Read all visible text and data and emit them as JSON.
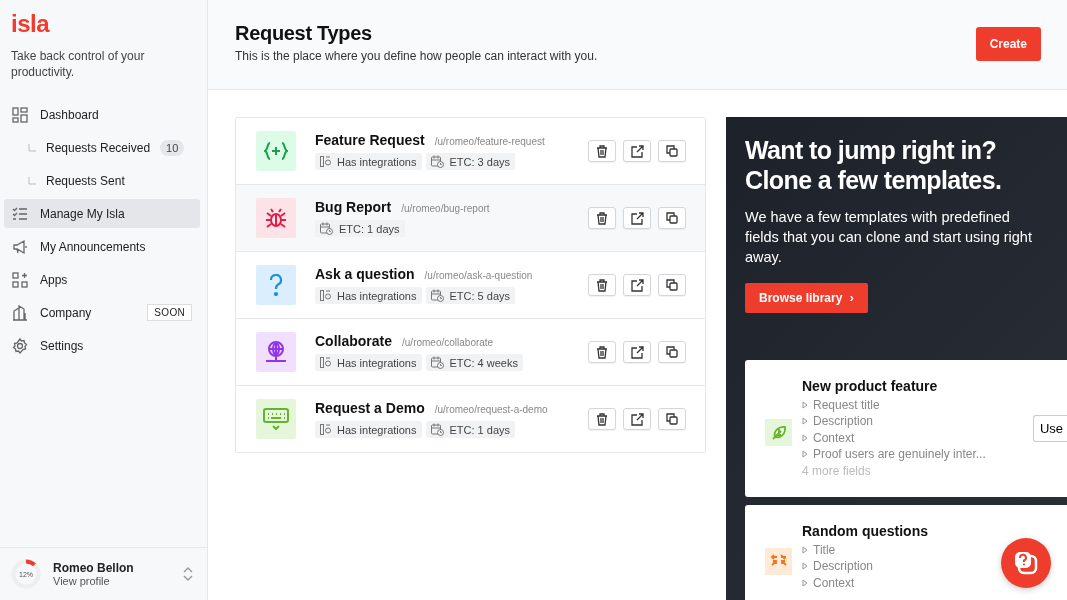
{
  "brand": {
    "logo": "isla",
    "tagline": "Take back control of your productivity."
  },
  "nav": [
    {
      "kind": "item",
      "label": "Dashboard",
      "selected": false
    },
    {
      "kind": "sub",
      "label": "Requests Received",
      "count": "10",
      "selected": false
    },
    {
      "kind": "sub",
      "label": "Requests Sent",
      "selected": false
    },
    {
      "kind": "item",
      "label": "Manage My Isla",
      "selected": true
    },
    {
      "kind": "item",
      "label": "My Announcements",
      "selected": false
    },
    {
      "kind": "item",
      "label": "Apps",
      "selected": false
    },
    {
      "kind": "item",
      "label": "Company",
      "tag": "SOON",
      "selected": false
    },
    {
      "kind": "item",
      "label": "Settings",
      "selected": false
    }
  ],
  "profile": {
    "name": "Romeo Bellon",
    "link": "View profile",
    "progress_label": "12%",
    "level": 0.12
  },
  "header": {
    "title": "Request Types",
    "subtitle": "This is the place where you define how people can interact with you.",
    "action": "Create"
  },
  "request_types": [
    {
      "name": "Feature Request",
      "path": "/u/romeo/feature-request",
      "integrations": "Has integrations",
      "etc": "ETC: 3 days"
    },
    {
      "name": "Bug Report",
      "path": "/u/romeo/bug-report",
      "etc": "ETC: 1 days"
    },
    {
      "name": "Ask a question",
      "path": "/u/romeo/ask-a-question",
      "integrations": "Has integrations",
      "etc": "ETC: 5 days"
    },
    {
      "name": "Collaborate",
      "path": "/u/romeo/collaborate",
      "integrations": "Has integrations",
      "etc": "ETC: 4 weeks"
    },
    {
      "name": "Request a Demo",
      "path": "/u/romeo/request-a-demo",
      "integrations": "Has integrations",
      "etc": "ETC: 1 days"
    }
  ],
  "promo": {
    "title": "Want to jump right in? Clone a few templates.",
    "body": "We have a few templates with predefined fields that you can clone and start using right away.",
    "action": "Browse library",
    "arrow": "›"
  },
  "templates": [
    {
      "name": "New product feature",
      "fields": [
        "Request title",
        "Description",
        "Context",
        "Proof users are genuinely inter..."
      ],
      "more": "4 more fields",
      "action": "Use"
    },
    {
      "name": "Random questions",
      "fields": [
        "Title",
        "Description",
        "Context"
      ]
    }
  ]
}
